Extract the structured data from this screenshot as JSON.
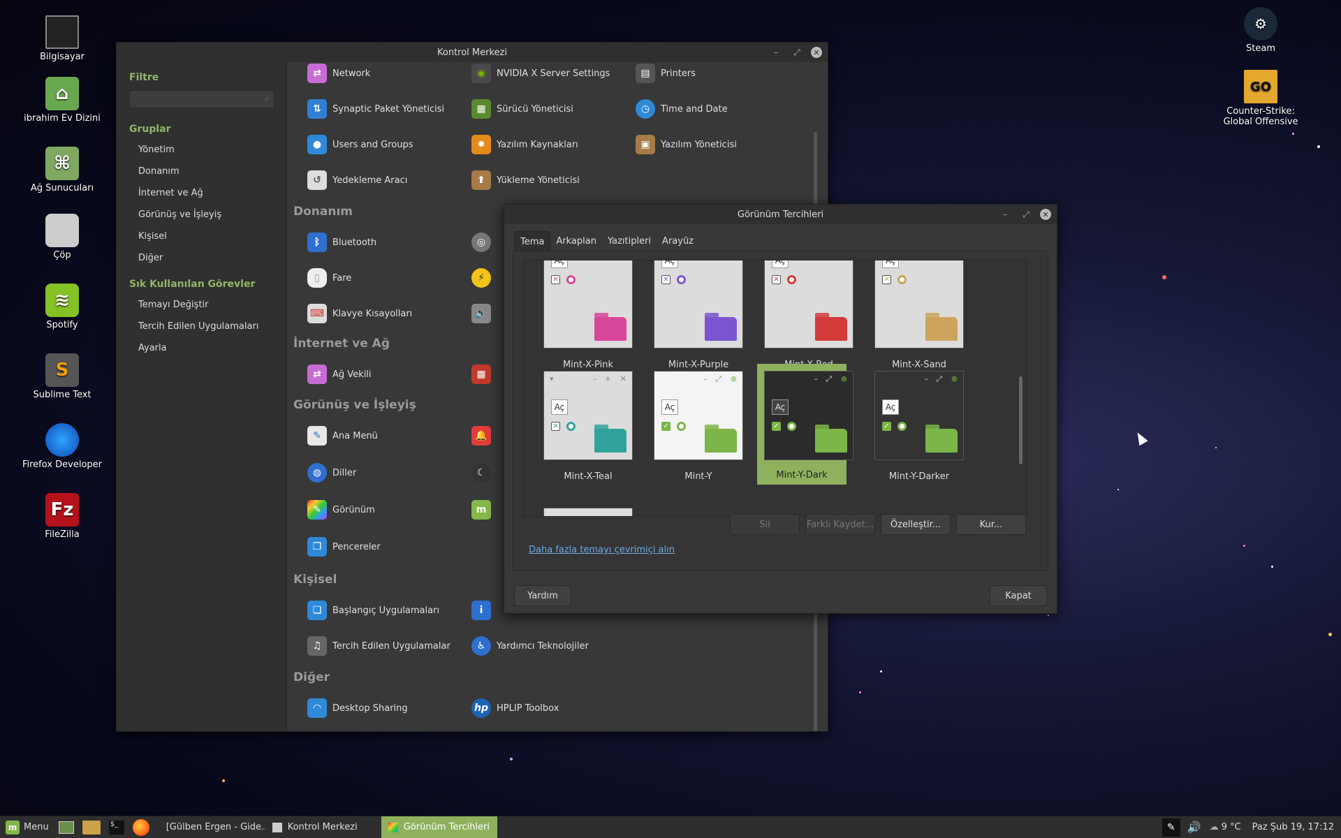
{
  "desktop": {
    "icons_left": [
      {
        "label": "Bilgisayar",
        "icon": "computer-icon"
      },
      {
        "label": "ibrahim Ev Dizini",
        "icon": "home-folder-icon"
      },
      {
        "label": "Ağ Sunucuları",
        "icon": "network-servers-icon"
      },
      {
        "label": "Çöp",
        "icon": "trash-icon"
      },
      {
        "label": "Spotify",
        "icon": "spotify-icon"
      },
      {
        "label": "Sublime Text",
        "icon": "sublime-text-icon"
      },
      {
        "label": "Firefox Developer",
        "icon": "firefox-developer-icon"
      },
      {
        "label": "FileZilla",
        "icon": "filezilla-icon"
      }
    ],
    "icons_right": [
      {
        "label": "Steam",
        "icon": "steam-icon"
      },
      {
        "label": "Counter-Strike: Global Offensive",
        "icon": "csgo-icon",
        "badge": "GO"
      }
    ]
  },
  "control_center": {
    "title": "Kontrol Merkezi",
    "sidebar": {
      "filter_heading": "Filtre",
      "groups_heading": "Gruplar",
      "groups": [
        "Yönetim",
        "Donanım",
        "İnternet ve Ağ",
        "Görünüş ve İşleyiş",
        "Kişisel",
        "Diğer"
      ],
      "tasks_heading": "Sık Kullanılan Görevler",
      "tasks": [
        "Temayı Değiştir",
        "Tercih Edilen Uygulamaları Ayarla"
      ]
    },
    "sections": {
      "donanim": "Donanım",
      "internet": "İnternet ve Ağ",
      "gorunus": "Görünüş ve İşleyiş",
      "kisisel": "Kişisel",
      "diger": "Diğer"
    },
    "apps": {
      "network": "Network",
      "nvidia": "NVIDIA X Server Settings",
      "printers": "Printers",
      "synaptic": "Synaptic Paket Yöneticisi",
      "driver": "Sürücü Yöneticisi",
      "time": "Time and Date",
      "users": "Users and Groups",
      "sources": "Yazılım Kaynakları",
      "software": "Yazılım Yöneticisi",
      "backup": "Yedekleme Aracı",
      "upload": "Yükleme Yöneticisi",
      "bluetooth": "Bluetooth",
      "mouse": "Fare",
      "keyboard": "Klavye Kısayolları",
      "proxy": "Ağ Vekili",
      "menu": "Ana Menü",
      "languages": "Diller",
      "appearance": "Görünüm",
      "windows": "Pencereler",
      "startup": "Başlangıç Uygulamaları",
      "preferred": "Tercih Edilen Uygulamalar",
      "assistive": "Yardımcı Teknolojiler",
      "desktop_sharing": "Desktop Sharing",
      "hplip": "HPLIP Toolbox"
    }
  },
  "appearance": {
    "title": "Görünüm Tercihleri",
    "tabs": [
      "Tema",
      "Arkaplan",
      "Yazıtipleri",
      "Arayüz"
    ],
    "preview_label": "Aç",
    "themes": [
      {
        "name": "Mint-X-Pink",
        "color": "#d8479a"
      },
      {
        "name": "Mint-X-Purple",
        "color": "#7b55d1"
      },
      {
        "name": "Mint-X-Red",
        "color": "#d33b3b"
      },
      {
        "name": "Mint-X-Sand",
        "color": "#cda45d"
      },
      {
        "name": "Mint-X-Teal",
        "color": "#2fa39b"
      },
      {
        "name": "Mint-Y",
        "color": "#7cb548"
      },
      {
        "name": "Mint-Y-Dark",
        "color": "#7cb548"
      },
      {
        "name": "Mint-Y-Darker",
        "color": "#7cb548"
      }
    ],
    "selected_theme": "Mint-Y-Dark",
    "buttons": {
      "delete": "Sil",
      "save_as": "Farklı Kaydet...",
      "customize": "Özelleştir...",
      "install": "Kur..."
    },
    "link": "Daha fazla temayı çevrimiçi alın",
    "help": "Yardım",
    "close": "Kapat"
  },
  "taskbar": {
    "menu": "Menu",
    "tasks": [
      "[Gülben Ergen - Gide...",
      "Kontrol Merkezi",
      "Görünüm Tercihleri"
    ],
    "active_task": "Görünüm Tercihleri",
    "weather": "9 °C",
    "clock": "Paz Şub 19, 17:12"
  },
  "colors": {
    "accent": "#8fb15e",
    "section_heading": "#8fb666"
  }
}
